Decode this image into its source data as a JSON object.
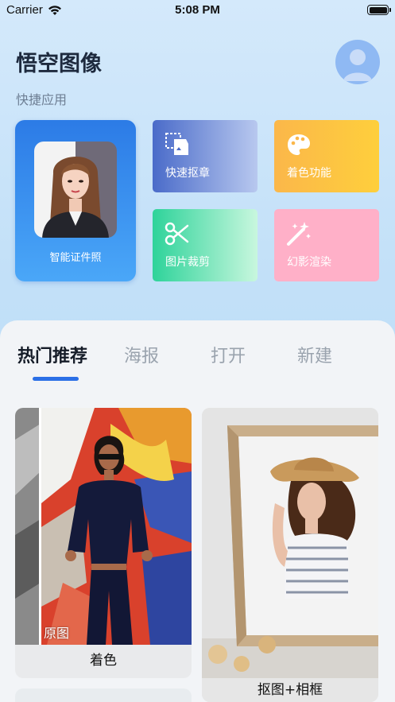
{
  "status_bar": {
    "carrier": "Carrier",
    "time": "5:08 PM"
  },
  "header": {
    "title": "悟空图像",
    "section_label": "快捷应用"
  },
  "quick_apps": {
    "id_photo": "智能证件照",
    "cutout": "快速抠章",
    "colorize": "着色功能",
    "crop": "图片裁剪",
    "render": "幻影渲染"
  },
  "tabs": [
    {
      "label": "热门推荐",
      "active": true
    },
    {
      "label": "海报",
      "active": false
    },
    {
      "label": "打开",
      "active": false
    },
    {
      "label": "新建",
      "active": false
    }
  ],
  "cards": {
    "left": {
      "caption": "着色",
      "tag": "原图"
    },
    "right": {
      "caption": "抠图+相框"
    }
  },
  "colors": {
    "accent": "#2b6fe6",
    "title": "#1e2a3e"
  }
}
